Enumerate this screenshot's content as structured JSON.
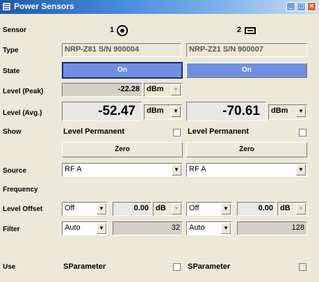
{
  "window": {
    "title": "Power Sensors"
  },
  "labels": {
    "sensor": "Sensor",
    "type": "Type",
    "state": "State",
    "level_peak": "Level (Peak)",
    "level_avg": "Level (Avg.)",
    "show": "Show",
    "source": "Source",
    "frequency": "Frequency",
    "level_offset": "Level Offset",
    "filter": "Filter",
    "use": "Use"
  },
  "sensor1": {
    "number": "1",
    "icon": "knob-icon",
    "type": "NRP-Z81 S/N 900004",
    "state": "On",
    "level_peak": "-22.28",
    "level_peak_unit": "dBm",
    "level_avg": "-52.47",
    "level_avg_unit": "dBm",
    "show_label": "Level Permanent",
    "zero": "Zero",
    "source": "RF A",
    "offset_mode": "Off",
    "offset_value": "0.00",
    "offset_unit": "dB",
    "filter_mode": "Auto",
    "filter_value": "32",
    "use_label": "SParameter"
  },
  "sensor2": {
    "number": "2",
    "icon": "plug-icon",
    "type": "NRP-Z21 S/N 900007",
    "state": "On",
    "level_avg": "-70.61",
    "level_avg_unit": "dBm",
    "show_label": "Level Permanent",
    "zero": "Zero",
    "source": "RF A",
    "offset_mode": "Off",
    "offset_value": "0.00",
    "offset_unit": "dB",
    "filter_mode": "Auto",
    "filter_value": "128",
    "use_label": "SParameter"
  }
}
